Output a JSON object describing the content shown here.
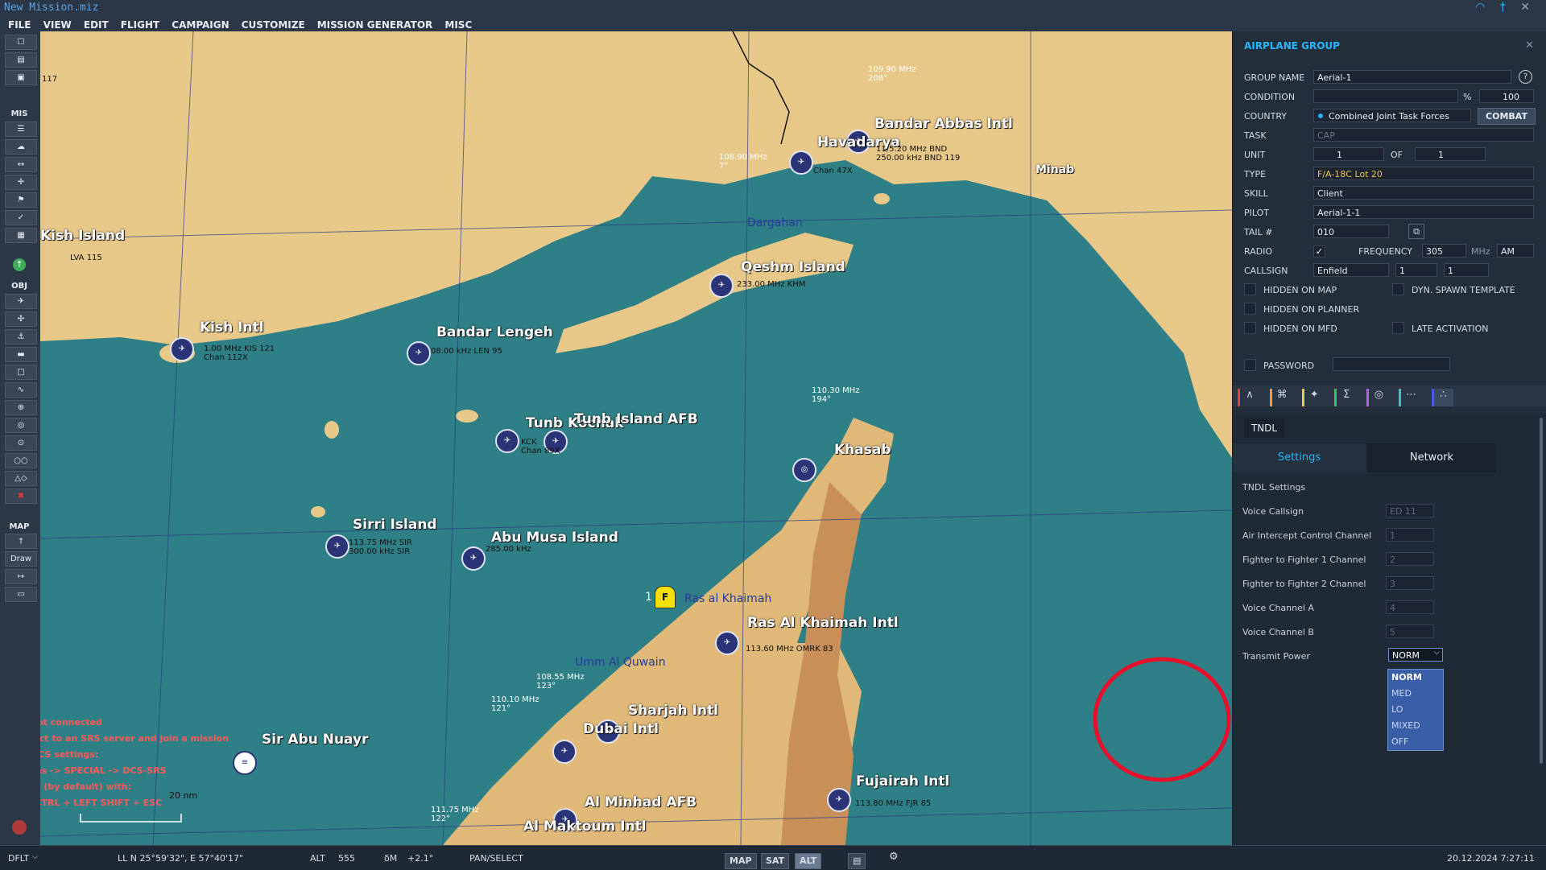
{
  "window": {
    "title": "New Mission.miz"
  },
  "menu": [
    "FILE",
    "VIEW",
    "EDIT",
    "FLIGHT",
    "CAMPAIGN",
    "CUSTOMIZE",
    "MISSION GENERATOR",
    "MISC"
  ],
  "toolbar": {
    "mis_label": "MIS",
    "obj_label": "OBJ",
    "map_label": "MAP",
    "draw_label": "Draw"
  },
  "map": {
    "labels": {
      "bandar_abbas": "Bandar Abbas Intl",
      "havadarya": "Havadarya",
      "minab": "Minab",
      "qeshm": "Qeshm Island",
      "dargahan": "Dargahan",
      "kish": "Kish Intl",
      "kish_island": "Kish Island",
      "bandar_lengeh": "Bandar Lengeh",
      "tunb_kochak": "Tunb Kochak",
      "tunb_island": "Tunb Island AFB",
      "khasab": "Khasab",
      "sirri": "Sirri Island",
      "abu_musa": "Abu Musa Island",
      "ras_al_khaimah_town": "Ras al Khaimah",
      "ras_al_khaimah": "Ras Al Khaimah Intl",
      "umm_al_quwain": "Umm Al Quwain",
      "sharjah": "Sharjah Intl",
      "dubai": "Dubai Intl",
      "al_minhad": "Al Minhad AFB",
      "al_maktoum": "Al Maktoum Intl",
      "fujairah": "Fujairah Intl",
      "sir_abu_nuayr": "Sir Abu Nuayr",
      "scale": "20 nm",
      "flight_marker": "F",
      "flight_num": "1"
    },
    "freqs": {
      "bandar_abbas": "109.90 MHz\n208°",
      "bandar_abbas_bnd": "11/5.20 MHz BND\n250.00 kHz BND 119",
      "havadarya": "108.90 MHz\n7°",
      "havadarya_chan": "Chan 47X",
      "qeshm": "233.00 MHz KHM",
      "kish": "1.00 MHz KIS 121\nChan 112X",
      "lengeh": "08.00 kHz LEN 95",
      "tunb": "KCK\nChan 89X",
      "khasab": "110.30 MHz\n194°",
      "sirri": "113.75 MHz SIR\n300.00 kHz SIR",
      "abu_musa": "285.00 kHz",
      "rak": "113.60 MHz OMRK 83",
      "sharjah": "108.55 MHz\n123°",
      "dubai": "110.10 MHz\n121°",
      "fujairah": "113.80 MHz FJR 85",
      "minhad": "111.75 MHz\n122°",
      "kish_lva": "LVA 115",
      "top_left": "117"
    },
    "srs": [
      "SRS not connected",
      "Connect to an SRS server and join a mission",
      "SRS DCS settings:",
      "Options -> SPECIAL -> DCS-SRS",
      "Toggle (by default) with:",
      "LEFT CTRL + LEFT SHIFT + ESC"
    ]
  },
  "panel": {
    "title": "AIRPLANE GROUP",
    "group_name_label": "GROUP NAME",
    "group_name": "Aerial-1",
    "condition_label": "CONDITION",
    "condition_pct": "%",
    "condition_value": "100",
    "country_label": "COUNTRY",
    "country": "Combined Joint Task Forces",
    "combat": "COMBAT",
    "task_label": "TASK",
    "task": "CAP",
    "unit_label": "UNIT",
    "unit": "1",
    "of_label": "OF",
    "of": "1",
    "type_label": "TYPE",
    "type": "F/A-18C Lot 20",
    "skill_label": "SKILL",
    "skill": "Client",
    "pilot_label": "PILOT",
    "pilot": "Aerial-1-1",
    "tail_label": "TAIL #",
    "tail": "010",
    "radio_label": "RADIO",
    "frequency_label": "FREQUENCY",
    "frequency": "305",
    "mhz": "MHz",
    "modulation": "AM",
    "callsign_label": "CALLSIGN",
    "callsign": "Enfield",
    "callsign_n1": "1",
    "callsign_n2": "1",
    "hidden_map": "HIDDEN ON MAP",
    "dyn_spawn": "DYN. SPAWN TEMPLATE",
    "hidden_planner": "HIDDEN ON PLANNER",
    "hidden_mfd": "HIDDEN ON MFD",
    "late_activation": "LATE ACTIVATION",
    "password": "PASSWORD",
    "tndl": {
      "tab": "TNDL",
      "settings_tab": "Settings",
      "network_tab": "Network",
      "section": "TNDL Settings",
      "fields": [
        {
          "label": "Voice Callsign",
          "value": "ED 11"
        },
        {
          "label": "Air Intercept Control Channel",
          "value": "1"
        },
        {
          "label": "Fighter to Fighter 1 Channel",
          "value": "2"
        },
        {
          "label": "Fighter to Fighter 2 Channel",
          "value": "3"
        },
        {
          "label": "Voice Channel A",
          "value": "4"
        },
        {
          "label": "Voice Channel B",
          "value": "5"
        }
      ],
      "transmit_label": "Transmit Power",
      "transmit_value": "NORM",
      "options": [
        "NORM",
        "MED",
        "LO",
        "MIXED",
        "OFF"
      ]
    }
  },
  "status": {
    "profile": "DFLT",
    "coords": "LL   N 25°59'32\", E 57°40'17\"",
    "alt_label": "ALT",
    "alt": "555",
    "dm_label": "δM",
    "dm": "+2.1°",
    "mode": "PAN/SELECT",
    "btn_map": "MAP",
    "btn_sat": "SAT",
    "btn_alt": "ALT",
    "datetime": "20.12.2024 7:27:11"
  },
  "colors": {
    "accent": "#27b6ff",
    "sea": "#2f7f86",
    "land": "#e8c888",
    "highlight_circle": "#e8102a",
    "dropdown": "#3a5fa8"
  }
}
